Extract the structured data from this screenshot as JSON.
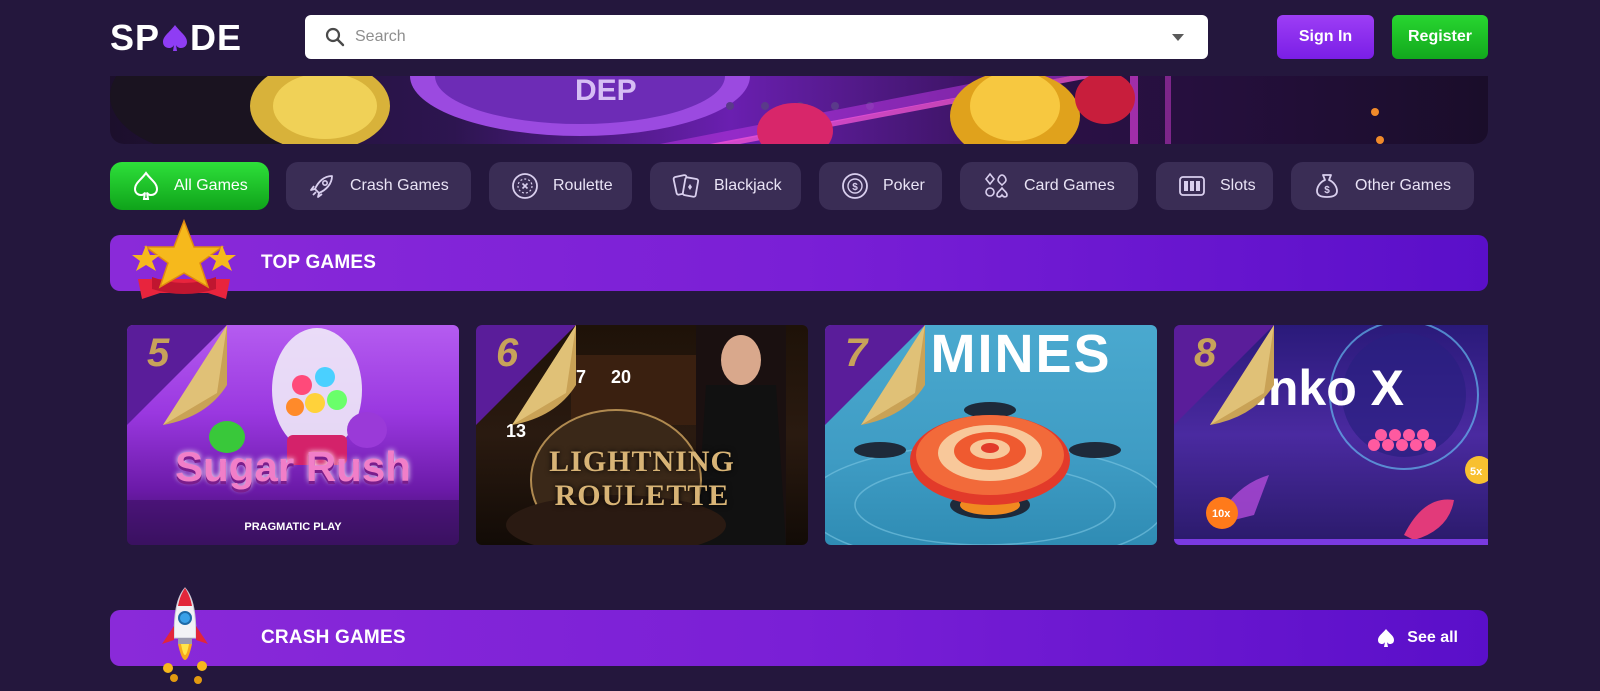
{
  "header": {
    "logo_left": "SP",
    "logo_right": "DE",
    "search_placeholder": "Search",
    "signin_label": "Sign In",
    "register_label": "Register"
  },
  "categories": [
    {
      "label": "All Games",
      "icon": "spade-icon",
      "active": true
    },
    {
      "label": "Crash Games",
      "icon": "rocket-icon",
      "active": false
    },
    {
      "label": "Roulette",
      "icon": "roulette-icon",
      "active": false
    },
    {
      "label": "Blackjack",
      "icon": "cards-icon",
      "active": false
    },
    {
      "label": "Poker",
      "icon": "poker-chip-icon",
      "active": false
    },
    {
      "label": "Card Games",
      "icon": "card-suits-icon",
      "active": false
    },
    {
      "label": "Slots",
      "icon": "slot-machine-icon",
      "active": false
    },
    {
      "label": "Other Games",
      "icon": "money-bag-icon",
      "active": false
    }
  ],
  "top_games": {
    "title": "TOP GAMES",
    "games": [
      {
        "rank": "5",
        "name": "Sugar Rush",
        "provider": "PRAGMATIC PLAY"
      },
      {
        "rank": "6",
        "name": "LIGHTNING ROULETTE",
        "provider": ""
      },
      {
        "rank": "7",
        "name": "MINES",
        "provider": ""
      },
      {
        "rank": "8",
        "name": "inko X",
        "provider": ""
      }
    ]
  },
  "crash_games": {
    "title": "CRASH GAMES",
    "see_all_label": "See all"
  },
  "colors": {
    "background": "#24173d",
    "accent_purple": "#8a2ad9",
    "accent_green": "#1fc42a",
    "tab_bg": "#3a2d55"
  }
}
